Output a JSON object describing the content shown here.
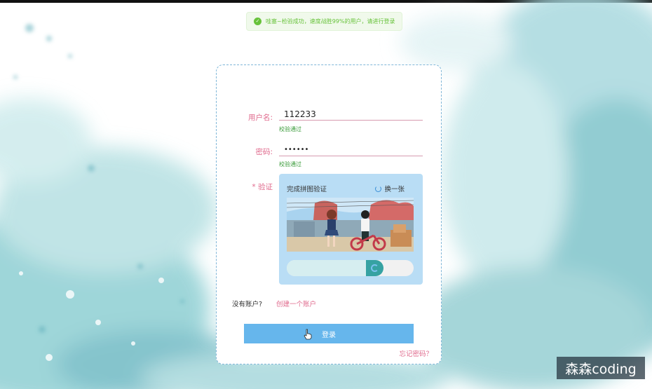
{
  "toast": {
    "text": "哇塞~检验成功，速度战胜99%的用户，请进行登录",
    "icon": "check-circle-icon"
  },
  "form": {
    "username": {
      "label": "用户名:",
      "value": "112233",
      "hint": "校验通过"
    },
    "password": {
      "label": "密码:",
      "value": "••••••",
      "hint": "校验通过"
    },
    "verify": {
      "label": "* 验证"
    }
  },
  "captcha": {
    "title": "完成拼图验证",
    "refresh_label": "换一张",
    "slider_progress": 0.69
  },
  "links": {
    "no_account": "没有账户?",
    "create_account": "创建一个账户",
    "forgot": "忘记密码？"
  },
  "login_button": "登录",
  "watermark": "森森coding",
  "colors": {
    "accent_pink": "#e06b8e",
    "button_blue": "#66b6ec",
    "success_green": "#67c23a"
  }
}
